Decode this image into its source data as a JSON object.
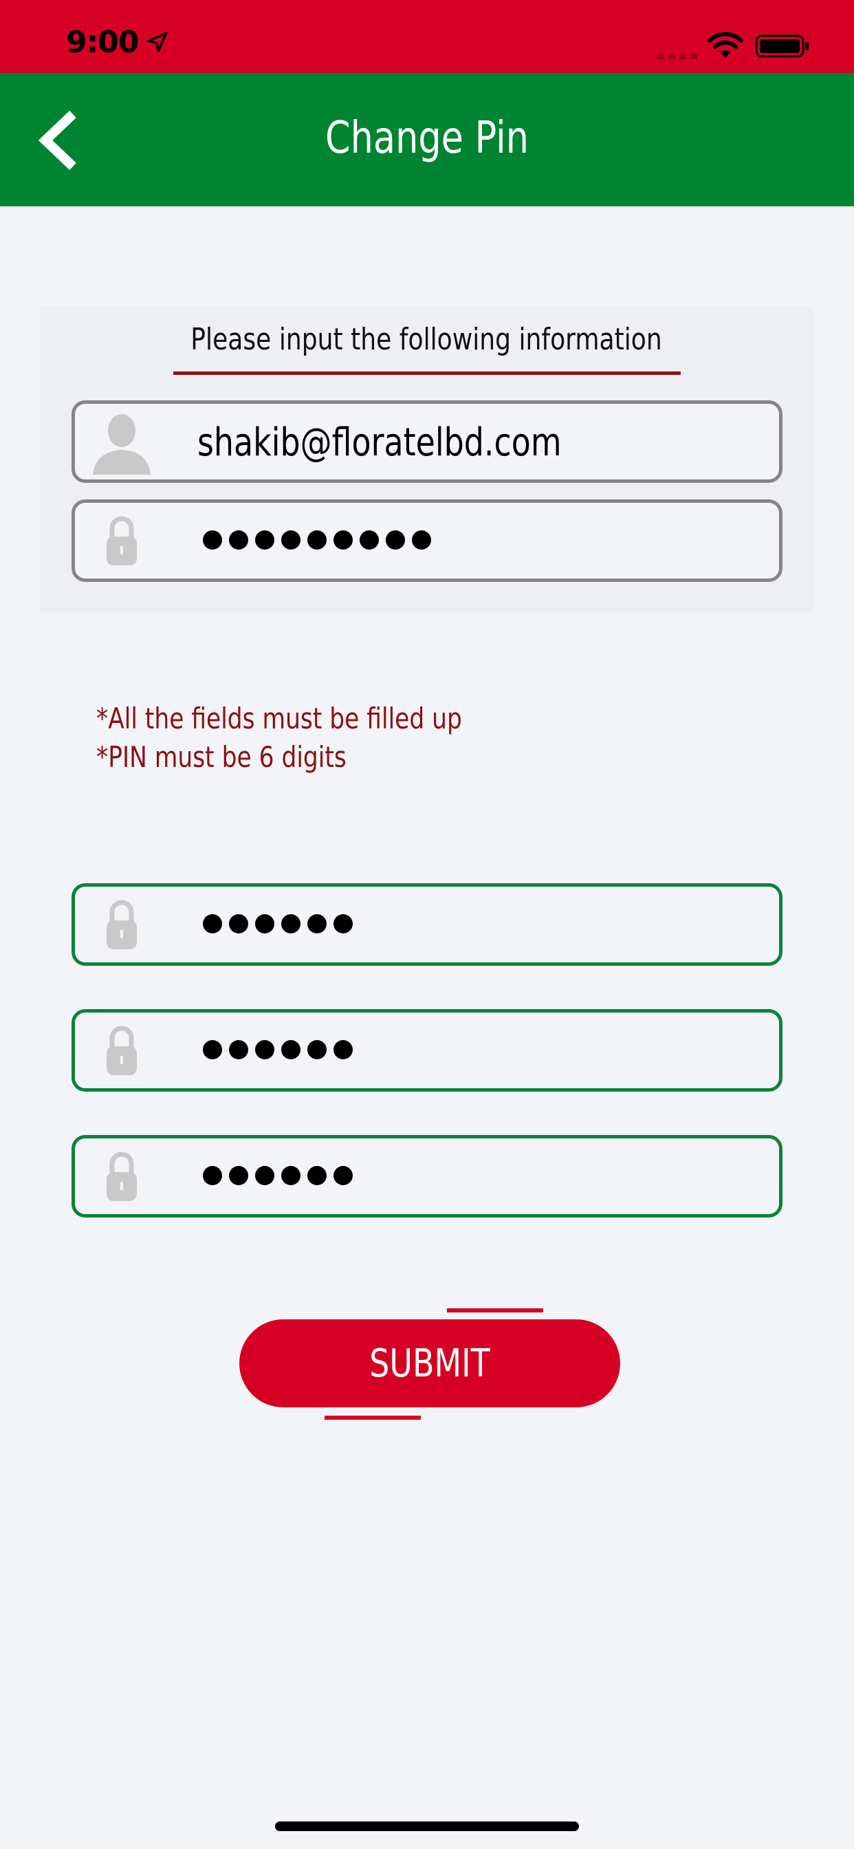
{
  "status_bar": {
    "time": "9:00",
    "icons": [
      "location-arrow-icon",
      "cellular-signal-icon",
      "wifi-icon",
      "battery-icon"
    ],
    "background": "#d60025"
  },
  "header": {
    "title": "Change Pin",
    "back_icon": "chevron-left-icon",
    "background": "#008432"
  },
  "info_panel": {
    "heading": "Please input the following information",
    "email": {
      "value": "shakib@floratelbd.com",
      "icon": "user-silhouette-icon"
    },
    "password": {
      "masked_length": 9,
      "icon": "padlock-icon"
    }
  },
  "rules": [
    "*All the fields must be filled up",
    "*PIN must be 6 digits"
  ],
  "pin_fields": [
    {
      "name": "current-pin",
      "masked_length": 6,
      "icon": "padlock-icon"
    },
    {
      "name": "new-pin",
      "masked_length": 6,
      "icon": "padlock-icon"
    },
    {
      "name": "confirm-pin",
      "masked_length": 6,
      "icon": "padlock-icon"
    }
  ],
  "submit": {
    "label": "SUBMIT",
    "color": "#d60025"
  },
  "colors": {
    "accent_red": "#d60025",
    "brand_green": "#008432",
    "rule_text": "#8a1114",
    "field_border_grey": "#858585",
    "field_border_green": "#0a8438"
  }
}
